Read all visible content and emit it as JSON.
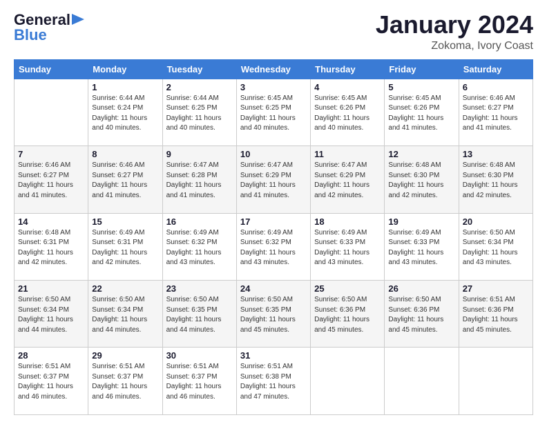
{
  "header": {
    "logo_general": "General",
    "logo_blue": "Blue",
    "month": "January 2024",
    "location": "Zokoma, Ivory Coast"
  },
  "days_of_week": [
    "Sunday",
    "Monday",
    "Tuesday",
    "Wednesday",
    "Thursday",
    "Friday",
    "Saturday"
  ],
  "weeks": [
    [
      {
        "day": "",
        "sunrise": "",
        "sunset": "",
        "daylight": ""
      },
      {
        "day": "1",
        "sunrise": "Sunrise: 6:44 AM",
        "sunset": "Sunset: 6:24 PM",
        "daylight": "Daylight: 11 hours and 40 minutes."
      },
      {
        "day": "2",
        "sunrise": "Sunrise: 6:44 AM",
        "sunset": "Sunset: 6:25 PM",
        "daylight": "Daylight: 11 hours and 40 minutes."
      },
      {
        "day": "3",
        "sunrise": "Sunrise: 6:45 AM",
        "sunset": "Sunset: 6:25 PM",
        "daylight": "Daylight: 11 hours and 40 minutes."
      },
      {
        "day": "4",
        "sunrise": "Sunrise: 6:45 AM",
        "sunset": "Sunset: 6:26 PM",
        "daylight": "Daylight: 11 hours and 40 minutes."
      },
      {
        "day": "5",
        "sunrise": "Sunrise: 6:45 AM",
        "sunset": "Sunset: 6:26 PM",
        "daylight": "Daylight: 11 hours and 41 minutes."
      },
      {
        "day": "6",
        "sunrise": "Sunrise: 6:46 AM",
        "sunset": "Sunset: 6:27 PM",
        "daylight": "Daylight: 11 hours and 41 minutes."
      }
    ],
    [
      {
        "day": "7",
        "sunrise": "Sunrise: 6:46 AM",
        "sunset": "Sunset: 6:27 PM",
        "daylight": "Daylight: 11 hours and 41 minutes."
      },
      {
        "day": "8",
        "sunrise": "Sunrise: 6:46 AM",
        "sunset": "Sunset: 6:27 PM",
        "daylight": "Daylight: 11 hours and 41 minutes."
      },
      {
        "day": "9",
        "sunrise": "Sunrise: 6:47 AM",
        "sunset": "Sunset: 6:28 PM",
        "daylight": "Daylight: 11 hours and 41 minutes."
      },
      {
        "day": "10",
        "sunrise": "Sunrise: 6:47 AM",
        "sunset": "Sunset: 6:29 PM",
        "daylight": "Daylight: 11 hours and 41 minutes."
      },
      {
        "day": "11",
        "sunrise": "Sunrise: 6:47 AM",
        "sunset": "Sunset: 6:29 PM",
        "daylight": "Daylight: 11 hours and 42 minutes."
      },
      {
        "day": "12",
        "sunrise": "Sunrise: 6:48 AM",
        "sunset": "Sunset: 6:30 PM",
        "daylight": "Daylight: 11 hours and 42 minutes."
      },
      {
        "day": "13",
        "sunrise": "Sunrise: 6:48 AM",
        "sunset": "Sunset: 6:30 PM",
        "daylight": "Daylight: 11 hours and 42 minutes."
      }
    ],
    [
      {
        "day": "14",
        "sunrise": "Sunrise: 6:48 AM",
        "sunset": "Sunset: 6:31 PM",
        "daylight": "Daylight: 11 hours and 42 minutes."
      },
      {
        "day": "15",
        "sunrise": "Sunrise: 6:49 AM",
        "sunset": "Sunset: 6:31 PM",
        "daylight": "Daylight: 11 hours and 42 minutes."
      },
      {
        "day": "16",
        "sunrise": "Sunrise: 6:49 AM",
        "sunset": "Sunset: 6:32 PM",
        "daylight": "Daylight: 11 hours and 43 minutes."
      },
      {
        "day": "17",
        "sunrise": "Sunrise: 6:49 AM",
        "sunset": "Sunset: 6:32 PM",
        "daylight": "Daylight: 11 hours and 43 minutes."
      },
      {
        "day": "18",
        "sunrise": "Sunrise: 6:49 AM",
        "sunset": "Sunset: 6:33 PM",
        "daylight": "Daylight: 11 hours and 43 minutes."
      },
      {
        "day": "19",
        "sunrise": "Sunrise: 6:49 AM",
        "sunset": "Sunset: 6:33 PM",
        "daylight": "Daylight: 11 hours and 43 minutes."
      },
      {
        "day": "20",
        "sunrise": "Sunrise: 6:50 AM",
        "sunset": "Sunset: 6:34 PM",
        "daylight": "Daylight: 11 hours and 43 minutes."
      }
    ],
    [
      {
        "day": "21",
        "sunrise": "Sunrise: 6:50 AM",
        "sunset": "Sunset: 6:34 PM",
        "daylight": "Daylight: 11 hours and 44 minutes."
      },
      {
        "day": "22",
        "sunrise": "Sunrise: 6:50 AM",
        "sunset": "Sunset: 6:34 PM",
        "daylight": "Daylight: 11 hours and 44 minutes."
      },
      {
        "day": "23",
        "sunrise": "Sunrise: 6:50 AM",
        "sunset": "Sunset: 6:35 PM",
        "daylight": "Daylight: 11 hours and 44 minutes."
      },
      {
        "day": "24",
        "sunrise": "Sunrise: 6:50 AM",
        "sunset": "Sunset: 6:35 PM",
        "daylight": "Daylight: 11 hours and 45 minutes."
      },
      {
        "day": "25",
        "sunrise": "Sunrise: 6:50 AM",
        "sunset": "Sunset: 6:36 PM",
        "daylight": "Daylight: 11 hours and 45 minutes."
      },
      {
        "day": "26",
        "sunrise": "Sunrise: 6:50 AM",
        "sunset": "Sunset: 6:36 PM",
        "daylight": "Daylight: 11 hours and 45 minutes."
      },
      {
        "day": "27",
        "sunrise": "Sunrise: 6:51 AM",
        "sunset": "Sunset: 6:36 PM",
        "daylight": "Daylight: 11 hours and 45 minutes."
      }
    ],
    [
      {
        "day": "28",
        "sunrise": "Sunrise: 6:51 AM",
        "sunset": "Sunset: 6:37 PM",
        "daylight": "Daylight: 11 hours and 46 minutes."
      },
      {
        "day": "29",
        "sunrise": "Sunrise: 6:51 AM",
        "sunset": "Sunset: 6:37 PM",
        "daylight": "Daylight: 11 hours and 46 minutes."
      },
      {
        "day": "30",
        "sunrise": "Sunrise: 6:51 AM",
        "sunset": "Sunset: 6:37 PM",
        "daylight": "Daylight: 11 hours and 46 minutes."
      },
      {
        "day": "31",
        "sunrise": "Sunrise: 6:51 AM",
        "sunset": "Sunset: 6:38 PM",
        "daylight": "Daylight: 11 hours and 47 minutes."
      },
      {
        "day": "",
        "sunrise": "",
        "sunset": "",
        "daylight": ""
      },
      {
        "day": "",
        "sunrise": "",
        "sunset": "",
        "daylight": ""
      },
      {
        "day": "",
        "sunrise": "",
        "sunset": "",
        "daylight": ""
      }
    ]
  ]
}
